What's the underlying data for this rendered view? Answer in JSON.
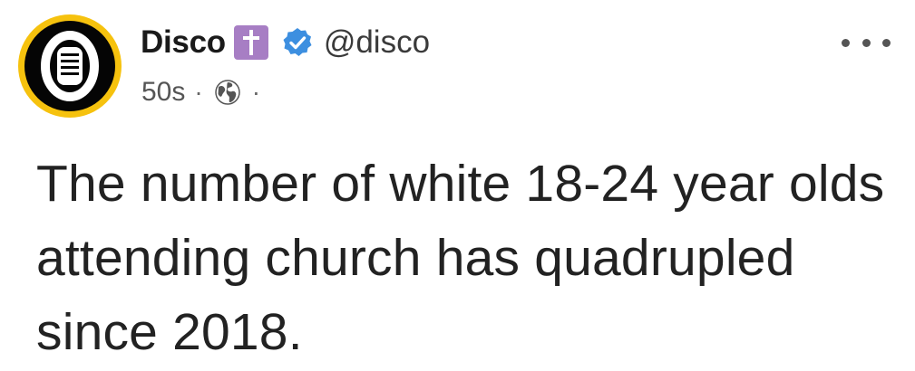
{
  "author": {
    "display_name": "Disco",
    "handle": "@disco",
    "verified": true,
    "badge_icon": "latin-cross-icon",
    "badge_color": "#a77ec4",
    "verified_color": "#3d8fe0",
    "avatar_ring_color": "#f6c20e"
  },
  "meta": {
    "timestamp": "50s",
    "separator": "·",
    "visibility_icon": "globe-icon"
  },
  "menu": {
    "icon": "more-options-icon"
  },
  "post": {
    "text": "The number of white 18-24 year olds attending church has quadrupled since 2018."
  }
}
